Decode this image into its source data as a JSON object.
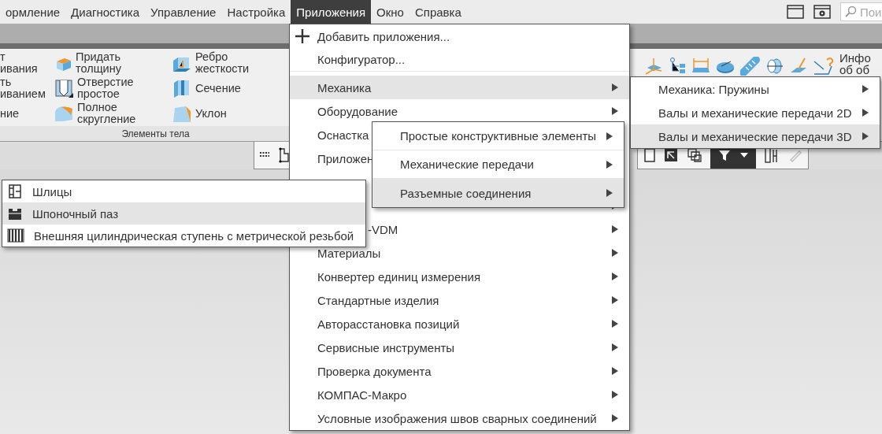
{
  "menubar": {
    "items": [
      {
        "label": "ормление",
        "selected": false
      },
      {
        "label": "Диагностика",
        "selected": false
      },
      {
        "label": "Управление",
        "selected": false
      },
      {
        "label": "Настройка",
        "selected": false
      },
      {
        "label": "Приложения",
        "selected": true
      },
      {
        "label": "Окно",
        "selected": false
      },
      {
        "label": "Справка",
        "selected": false
      }
    ],
    "search": {
      "placeholder": "Пои"
    }
  },
  "ribbon": {
    "columns": [
      [
        {
          "label": "т ивания"
        },
        {
          "label": "ть иванием"
        },
        {
          "label": "ние"
        }
      ],
      [
        {
          "label": "Придать толщину"
        },
        {
          "label": "Отверстие простое"
        },
        {
          "label": "Полное скругление"
        }
      ],
      [
        {
          "label": "Ребро жесткости"
        },
        {
          "label": "Сечение"
        },
        {
          "label": "Уклон"
        }
      ]
    ],
    "group_label": "Элементы тела",
    "info_button": {
      "label": "Инфо об об"
    }
  },
  "menus": [
    {
      "items": [
        {
          "label": "Добавить приложения...",
          "selected": false,
          "submenu": false
        },
        {
          "label": "Конфигуратор...",
          "selected": false,
          "submenu": false
        },
        {
          "label": "Механика",
          "selected": true,
          "submenu": true
        },
        {
          "label": "Оборудование",
          "selected": false,
          "submenu": true
        },
        {
          "label": "Оснастка",
          "selected": false,
          "submenu": false
        },
        {
          "label": "Приложен",
          "selected": false,
          "submenu": false
        },
        {
          "kind": "hidden"
        },
        {
          "selected": false,
          "submenu": true
        },
        {
          "kind": "partial",
          "label": "-VDM",
          "selected": false,
          "submenu": true
        },
        {
          "label": "Материалы",
          "selected": false,
          "submenu": true
        },
        {
          "label": "Конвертер единиц измерения",
          "selected": false,
          "submenu": true
        },
        {
          "label": "Стандартные изделия",
          "selected": false,
          "submenu": true
        },
        {
          "label": "Авторасстановка позиций",
          "selected": false,
          "submenu": true
        },
        {
          "label": "Сервисные инструменты",
          "selected": false,
          "submenu": true
        },
        {
          "label": "Проверка документа",
          "selected": false,
          "submenu": true
        },
        {
          "label": "КОМПАС-Макро",
          "selected": false,
          "submenu": true
        },
        {
          "label": "Условные изображения швов сварных соединений",
          "selected": false,
          "submenu": true
        }
      ]
    },
    {
      "items": [
        {
          "label": "Механика: Пружины",
          "selected": false,
          "submenu": true
        },
        {
          "label": "Валы и механические передачи 2D",
          "selected": false,
          "submenu": true
        },
        {
          "label": "Валы и механические передачи 3D",
          "selected": true,
          "submenu": true
        }
      ]
    },
    {
      "items": [
        {
          "label": "Простые конструктивные элементы",
          "selected": false,
          "submenu": true
        },
        {
          "label": "Механические передачи",
          "selected": false,
          "submenu": true
        },
        {
          "label": "Разъемные соединения",
          "selected": true,
          "submenu": true
        }
      ]
    },
    {
      "items": [
        {
          "label": "Шлицы",
          "selected": false,
          "submenu": false
        },
        {
          "label": "Шпоночный паз",
          "selected": true,
          "submenu": false
        },
        {
          "label": "Внешняя цилиндрическая ступень с метрической резьбой",
          "selected": false,
          "submenu": false
        }
      ]
    }
  ]
}
